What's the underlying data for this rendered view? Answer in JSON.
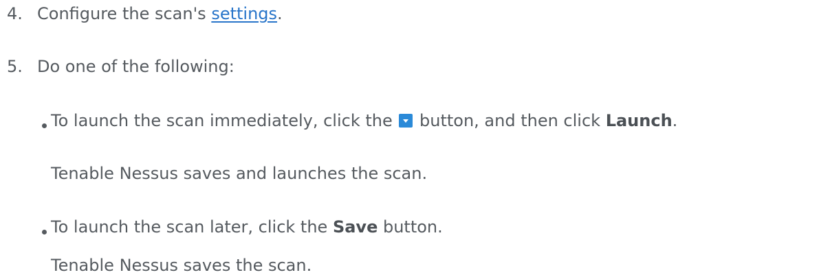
{
  "steps": [
    {
      "number": "4.",
      "text_before": "Configure the scan's ",
      "link_text": "settings",
      "text_after": "."
    },
    {
      "number": "5.",
      "text": "Do one of the following:"
    }
  ],
  "options": [
    {
      "text_before": "To launch the scan immediately, click the ",
      "icon": "dropdown-arrow-icon",
      "text_middle": " button, and then click ",
      "bold_text": "Launch",
      "text_after": ".",
      "result": "Tenable Nessus saves and launches the scan."
    },
    {
      "text_before": "To launch the scan later, click the ",
      "bold_text": "Save",
      "text_after": " button.",
      "result": "Tenable Nessus saves the scan."
    }
  ],
  "colors": {
    "text": "#555a5f",
    "link": "#2774c9",
    "icon_bg": "#2b8ad8"
  }
}
